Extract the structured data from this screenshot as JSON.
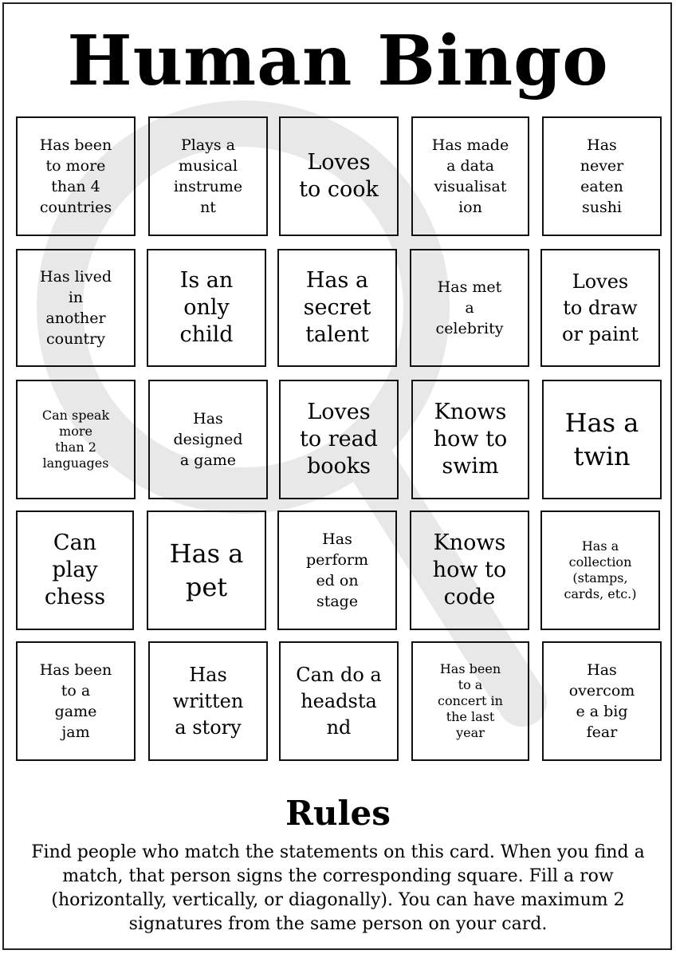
{
  "title": "Human Bingo",
  "cells": [
    {
      "text": "Has been\nto more\nthan 4\ncountries"
    },
    {
      "text": "Plays a\nmusical\ninstrume\nnt"
    },
    {
      "text": "Loves\nto cook"
    },
    {
      "text": "Has made\na data\nvisualisat\nion"
    },
    {
      "text": "Has\nnever\neaten\nsushi"
    },
    {
      "text": "Has lived\nin\nanother\ncountry"
    },
    {
      "text": "Is an\nonly\nchild"
    },
    {
      "text": "Has a\nsecret\ntalent"
    },
    {
      "text": "Has met\na\ncelebrity"
    },
    {
      "text": "Loves\nto draw\nor paint"
    },
    {
      "text": "Can speak\nmore\nthan 2\nlanguages"
    },
    {
      "text": "Has\ndesigned\na game"
    },
    {
      "text": "Loves\nto read\nbooks"
    },
    {
      "text": "Knows\nhow to\nswim"
    },
    {
      "text": "Has a\ntwin"
    },
    {
      "text": "Can\nplay\nchess"
    },
    {
      "text": "Has a\npet"
    },
    {
      "text": "Has\nperform\ned on\nstage"
    },
    {
      "text": "Knows\nhow to\ncode"
    },
    {
      "text": "Has a\ncollection\n(stamps,\ncards, etc.)"
    },
    {
      "text": "Has been\nto a\ngame\njam"
    },
    {
      "text": "Has\nwritten\na story"
    },
    {
      "text": "Can do a\nheadsta\nnd"
    },
    {
      "text": "Has been\nto a\nconcert in\nthe last\nyear"
    },
    {
      "text": "Has\novercom\ne a big\nfear"
    }
  ],
  "rules": {
    "title": "Rules",
    "text": "Find people who match the statements on this card. When you find a match, that person signs the corresponding square. Fill a row (horizontally, vertically, or diagonally). You can have maximum 2 signatures from the same person on your card."
  },
  "icons": {
    "watermark": "magnifier-watermark-icon"
  },
  "colors": {
    "watermark": "#e8e8e8",
    "border": "#111111",
    "text": "#000000"
  }
}
